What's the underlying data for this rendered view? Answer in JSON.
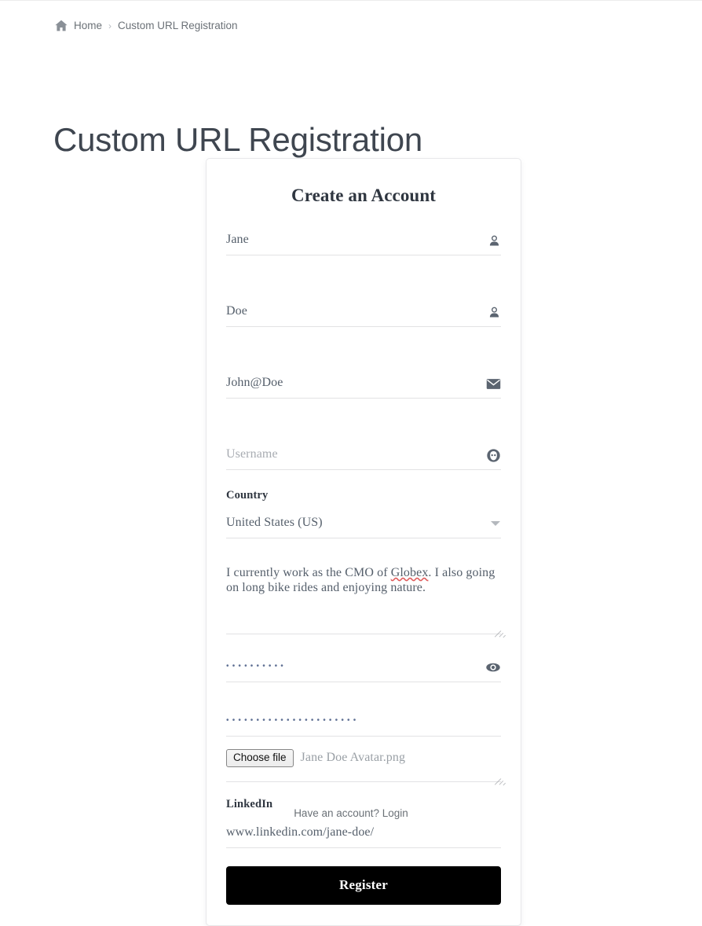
{
  "breadcrumb": {
    "home_icon": "home-icon",
    "home_label": "Home",
    "separator": "›",
    "current": "Custom URL Registration"
  },
  "page": {
    "title": "Custom URL Registration"
  },
  "card": {
    "title": "Create an Account",
    "fields": {
      "first_name": {
        "value": "Jane",
        "icon": "user-icon",
        "is_placeholder": false
      },
      "last_name": {
        "value": "Doe",
        "icon": "user-icon",
        "is_placeholder": false
      },
      "email": {
        "value": "John@Doe",
        "icon": "envelope-icon",
        "is_placeholder": false
      },
      "username": {
        "placeholder": "Username",
        "icon": "avatar-face-icon",
        "is_placeholder": true
      },
      "country": {
        "label": "Country",
        "value": "United States (US)",
        "icon": "chevron-down-icon"
      },
      "bio": {
        "text_before": "I currently work as the CMO of ",
        "misspelled": "Globex",
        "text_after": ". I also going on long bike rides and enjoying nature."
      },
      "password": {
        "value": "••••••••••",
        "icon": "eye-icon"
      },
      "confirm_password": {
        "value": "••••••••••••••••••••••"
      },
      "avatar": {
        "button_label": "Choose file",
        "file_name": "Jane Doe Avatar.png"
      },
      "linkedin": {
        "label": "LinkedIn",
        "value": "www.linkedin.com/jane-doe/"
      }
    },
    "submit_label": "Register"
  },
  "footer": {
    "text": "Have an account? Login"
  },
  "colors": {
    "page_bg": "#ffffff",
    "card_border": "#e8e8ea",
    "field_underline": "#e2e2e4",
    "text_dark": "#2f3640",
    "text_value": "#555f6b",
    "text_placeholder": "#a8acb2",
    "muted": "#6b7177",
    "button_bg": "#000000",
    "spellcheck_underline": "#e05d5d",
    "dots": "#5f7094"
  }
}
